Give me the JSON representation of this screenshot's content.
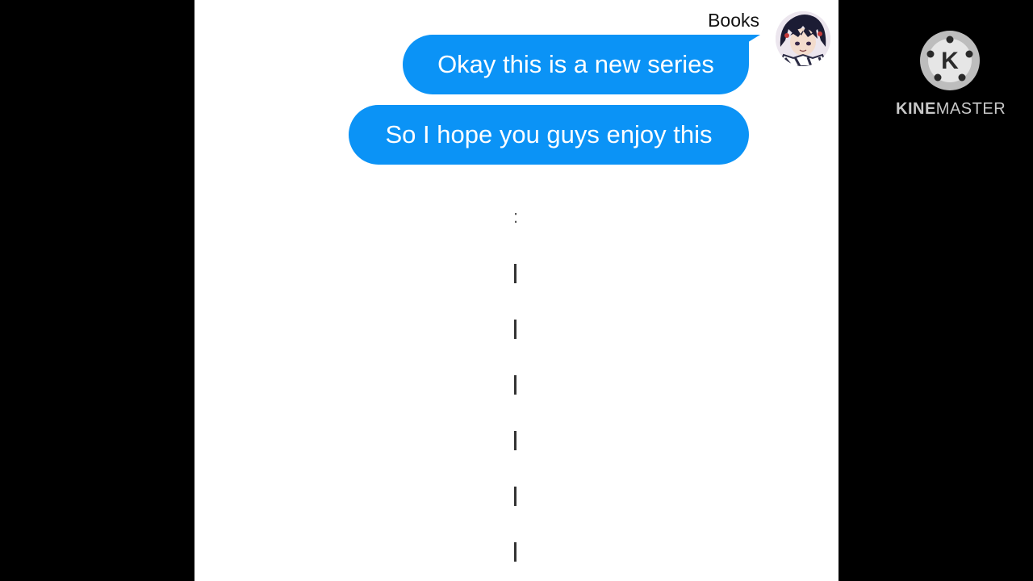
{
  "chat": {
    "sender_name": "Books",
    "messages": [
      {
        "text": "Okay this is a new series"
      },
      {
        "text": "So I hope you guys enjoy this"
      }
    ],
    "separator_colon": ":"
  },
  "watermark": {
    "brand_bold": "KINE",
    "brand_light": "MASTER",
    "logo_letter": "K"
  },
  "colors": {
    "bubble": "#0b93f6",
    "background": "#ffffff",
    "letterbox": "#000000"
  }
}
